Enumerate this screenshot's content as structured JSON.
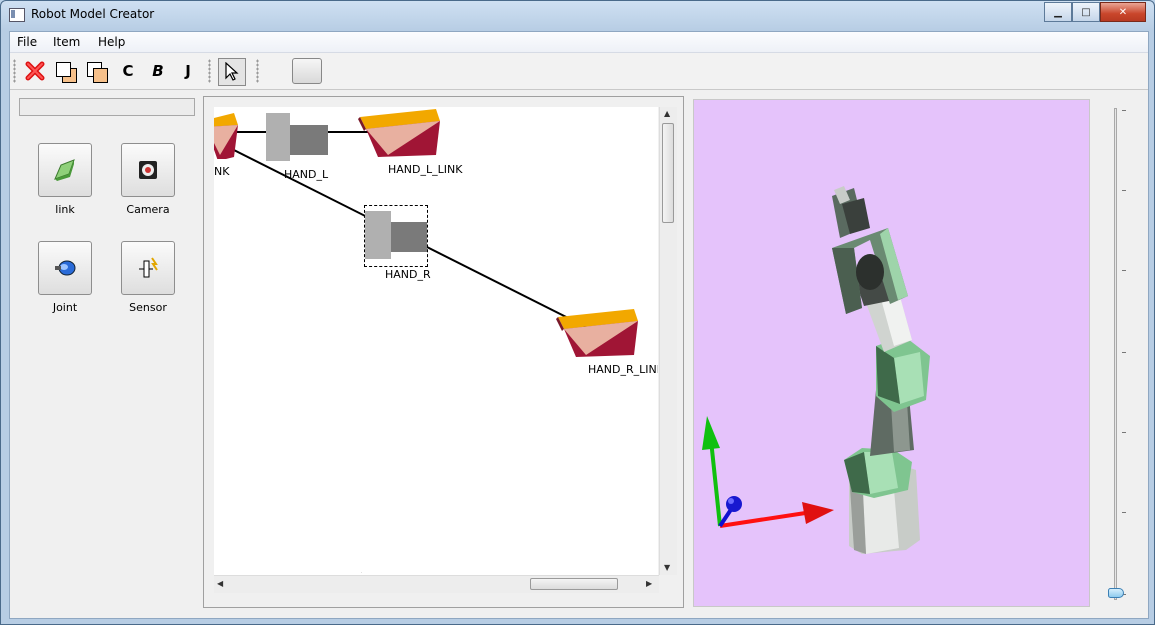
{
  "window": {
    "title": "Robot Model Creator",
    "minimize": "▁",
    "maximize": "□",
    "close": "✕"
  },
  "menu": {
    "file": "File",
    "item": "Item",
    "help": "Help"
  },
  "toolbar": {
    "delete_icon": "red-x-icon",
    "c_label": "C",
    "b_label": "B",
    "j_label": "J",
    "select_icon": "pointer-arrow-icon"
  },
  "palette": {
    "items": [
      {
        "label": "link",
        "icon": "link-block-icon"
      },
      {
        "label": "Camera",
        "icon": "camera-icon"
      },
      {
        "label": "Joint",
        "icon": "joint-motor-icon"
      },
      {
        "label": "Sensor",
        "icon": "sensor-icon"
      }
    ]
  },
  "scene": {
    "nodes": [
      {
        "label": "NK",
        "kind": "link"
      },
      {
        "label": "HAND_L",
        "kind": "joint"
      },
      {
        "label": "HAND_L_LINK",
        "kind": "link"
      },
      {
        "label": "HAND_R",
        "kind": "joint",
        "selected": true
      },
      {
        "label": "HAND_R_LINK",
        "kind": "link"
      }
    ]
  },
  "viewport": {
    "background": "#e5c3fb",
    "axis_colors": {
      "x": "#ff1010",
      "y": "#10c010",
      "z": "#1010d0"
    }
  },
  "zoom": {
    "level": 0.0
  }
}
